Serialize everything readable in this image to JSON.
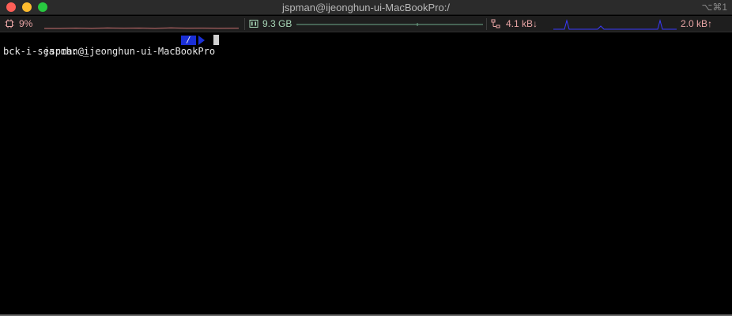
{
  "window": {
    "title": "jspman@ijeonghun-ui-MacBookPro:/",
    "shortcut": "⌥⌘1"
  },
  "statusbar": {
    "cpu": {
      "icon": "cpu-chip-icon",
      "value": "9%"
    },
    "memory": {
      "icon": "memory-icon",
      "value": "9.3 GB"
    },
    "network": {
      "icon": "network-icon",
      "download": "4.1 kB↓",
      "upload": "2.0 kB↑"
    },
    "colors": {
      "cpu": "#e9a5a5",
      "memory": "#a8d8b8",
      "net_spark": "#3a3aff"
    }
  },
  "terminal": {
    "prompt_user": "jspman@ijeonghun-ui-MacBookPro",
    "prompt_dir": "/",
    "search_line": "bck-i-search: _"
  }
}
